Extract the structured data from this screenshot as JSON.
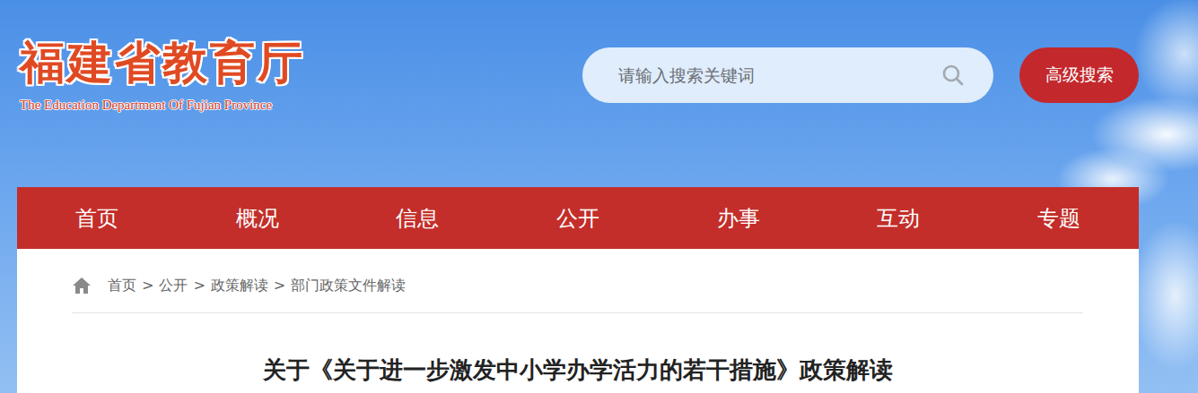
{
  "logo": {
    "title": "福建省教育厅",
    "subtitle": "The Education Department Of Fujian Province"
  },
  "search": {
    "placeholder": "请输入搜索关键词",
    "button": "高级搜索"
  },
  "nav": [
    {
      "label": "首页",
      "selected": false
    },
    {
      "label": "概况",
      "selected": false
    },
    {
      "label": "信息",
      "selected": false
    },
    {
      "label": "公开",
      "selected": false
    },
    {
      "label": "办事",
      "selected": false
    },
    {
      "label": "互动",
      "selected": false
    },
    {
      "label": "专题",
      "selected": false
    }
  ],
  "breadcrumb": {
    "items": [
      "首页",
      "公开",
      "政策解读",
      "部门政策文件解读"
    ],
    "separator": ">"
  },
  "article": {
    "title": "关于《关于进一步激发中小学办学活力的若干措施》政策解读"
  }
}
